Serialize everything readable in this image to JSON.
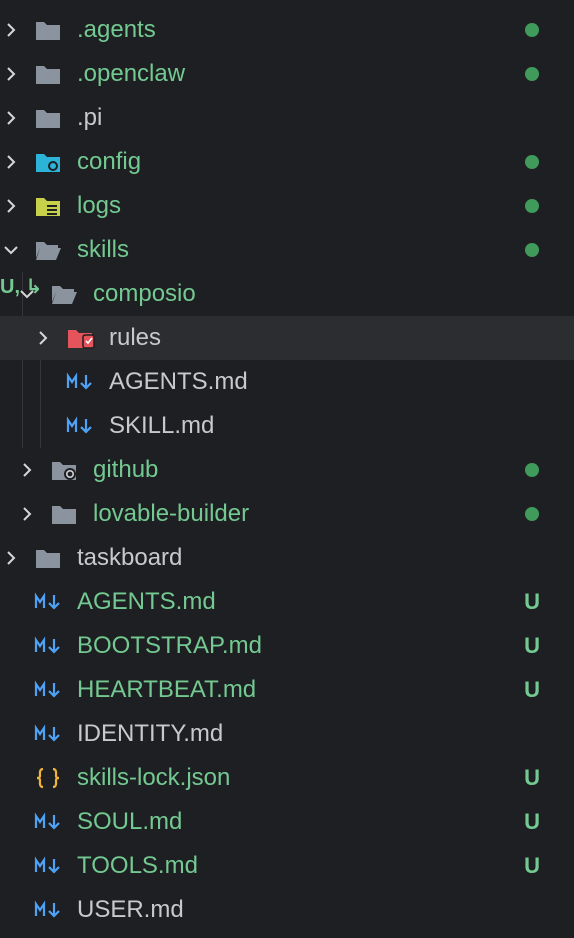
{
  "tree": [
    {
      "name": ".agents",
      "type": "folder",
      "expanded": false,
      "depth": 0,
      "status": "dot"
    },
    {
      "name": ".openclaw",
      "type": "folder",
      "expanded": false,
      "depth": 0,
      "status": "dot"
    },
    {
      "name": ".pi",
      "type": "folder",
      "expanded": false,
      "depth": 0,
      "status": ""
    },
    {
      "name": "config",
      "type": "folder-config",
      "expanded": false,
      "depth": 0,
      "status": "dot"
    },
    {
      "name": "logs",
      "type": "folder-logs",
      "expanded": false,
      "depth": 0,
      "status": "dot"
    },
    {
      "name": "skills",
      "type": "folder-open",
      "expanded": true,
      "depth": 0,
      "status": "dot"
    },
    {
      "name": "composio",
      "type": "folder-open",
      "expanded": true,
      "depth": 1,
      "status": "U, ↳"
    },
    {
      "name": "rules",
      "type": "folder-rules",
      "expanded": false,
      "depth": 2,
      "status": ""
    },
    {
      "name": "AGENTS.md",
      "type": "markdown",
      "depth": 2,
      "status": ""
    },
    {
      "name": "SKILL.md",
      "type": "markdown",
      "depth": 2,
      "status": ""
    },
    {
      "name": "github",
      "type": "folder-github",
      "expanded": false,
      "depth": 1,
      "status": "dot"
    },
    {
      "name": "lovable-builder",
      "type": "folder",
      "expanded": false,
      "depth": 1,
      "status": "dot"
    },
    {
      "name": "taskboard",
      "type": "folder",
      "expanded": false,
      "depth": 0,
      "status": ""
    },
    {
      "name": "AGENTS.md",
      "type": "markdown",
      "depth": 0,
      "status": "U"
    },
    {
      "name": "BOOTSTRAP.md",
      "type": "markdown",
      "depth": 0,
      "status": "U"
    },
    {
      "name": "HEARTBEAT.md",
      "type": "markdown",
      "depth": 0,
      "status": "U"
    },
    {
      "name": "IDENTITY.md",
      "type": "markdown",
      "depth": 0,
      "status": ""
    },
    {
      "name": "skills-lock.json",
      "type": "json",
      "depth": 0,
      "status": "U"
    },
    {
      "name": "SOUL.md",
      "type": "markdown",
      "depth": 0,
      "status": "U"
    },
    {
      "name": "TOOLS.md",
      "type": "markdown",
      "depth": 0,
      "status": "U"
    },
    {
      "name": "USER.md",
      "type": "markdown",
      "depth": 0,
      "status": ""
    }
  ],
  "colors": {
    "background": "#1e1f22",
    "selected_row": "#2b2d31",
    "untracked_text": "#73c991",
    "default_text": "#c7c9cc",
    "status_dot": "#3f9a5b",
    "folder": "#8b949e",
    "markdown_icon": "#4ea1f5",
    "json_icon": "#f0b43a",
    "rules_icon": "#e5535b",
    "config_icon": "#2bb3d8",
    "logs_icon": "#c7d24a"
  }
}
